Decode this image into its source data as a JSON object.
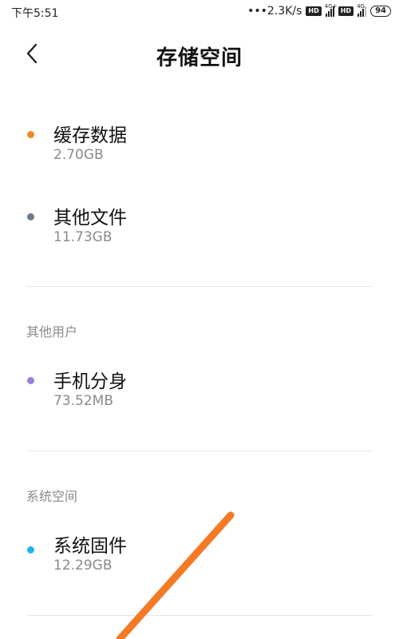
{
  "status_bar": {
    "time": "下午5:51",
    "speed": "•••2.3K/s",
    "hd1": "HD",
    "net1": "4G+",
    "hd2": "HD",
    "net2": "4G",
    "battery": "94"
  },
  "header": {
    "title": "存储空间",
    "back_icon": "chevron-left-icon"
  },
  "items": [
    {
      "name": "缓存数据",
      "size": "2.70GB",
      "color": "#f08a24"
    },
    {
      "name": "其他文件",
      "size": "11.73GB",
      "color": "#6b7b8c"
    },
    {
      "name": "手机分身",
      "size": "73.52MB",
      "color": "#9b7fd6"
    },
    {
      "name": "系统固件",
      "size": "12.29GB",
      "color": "#1bb6e8"
    }
  ],
  "sections": {
    "other_users": "其他用户",
    "system_space": "系统空间"
  },
  "annotation": {
    "color": "#f47a25",
    "icon": "annotation-arrow"
  }
}
